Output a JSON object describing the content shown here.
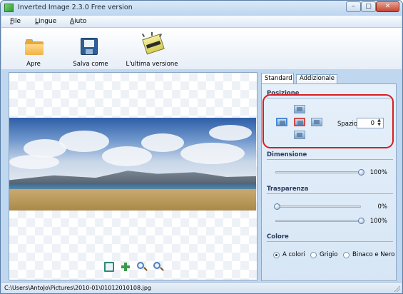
{
  "window": {
    "title": "Inverted Image 2.3.0 Free version",
    "controls": {
      "minimize": "–",
      "maximize": "□",
      "close": "✕"
    }
  },
  "menu": {
    "items": [
      {
        "label": "File"
      },
      {
        "label": "Lingue"
      },
      {
        "label": "Aiuto"
      }
    ]
  },
  "toolbar": {
    "open_label": "Apre",
    "save_label": "Salva come",
    "latest_label": "L'ultima versione"
  },
  "tabs": {
    "standard": "Standard",
    "additional": "Addizionale",
    "active": "Standard"
  },
  "panel": {
    "position": {
      "title": "Posizione",
      "spacing_label": "Spazio",
      "spacing_value": "0",
      "selected": "center",
      "highlighted": true
    },
    "dimension": {
      "title": "Dimensione",
      "value": "100%",
      "level": 1.0
    },
    "transparency": {
      "title": "Trasparenza",
      "slider1_value": "0%",
      "slider1_level": 0.0,
      "slider2_value": "100%",
      "slider2_level": 1.0
    },
    "color": {
      "title": "Colore",
      "options": [
        {
          "label": "A colori",
          "checked": true
        },
        {
          "label": "Grigio",
          "checked": false
        },
        {
          "label": "Binaco e Nero",
          "checked": false
        }
      ]
    }
  },
  "status": {
    "path": "C:\\Users\\AntoJo\\Pictures\\2010-01\\01012010108.jpg"
  },
  "colors": {
    "accent": "#4a8ad6",
    "highlight_ring": "#d81e1e",
    "window_frame": "#bfd7ef"
  }
}
